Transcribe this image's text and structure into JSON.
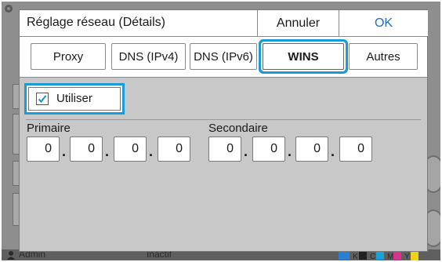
{
  "background": {
    "status_user": "Admin",
    "status_state": "Inactif",
    "ink_labels": [
      "K",
      "C",
      "M",
      "Y"
    ],
    "ink_colors": [
      "#222222",
      "#1aa3d9",
      "#d9338f",
      "#f0d21a"
    ]
  },
  "dialog": {
    "title": "Réglage réseau (Détails)",
    "cancel_label": "Annuler",
    "ok_label": "OK",
    "tabs": [
      {
        "label": "Proxy"
      },
      {
        "label": "DNS (IPv4)"
      },
      {
        "label": "DNS (IPv6)"
      },
      {
        "label": "WINS",
        "selected": true
      },
      {
        "label": "Autres"
      }
    ],
    "use_label": "Utiliser",
    "use_checked": true,
    "primary": {
      "label": "Primaire",
      "octets": [
        "0",
        "0",
        "0",
        "0"
      ]
    },
    "secondary": {
      "label": "Secondaire",
      "octets": [
        "0",
        "0",
        "0",
        "0"
      ]
    },
    "separator": ".",
    "accent_color": "#1a9ad6",
    "ok_color": "#1d6fc2"
  }
}
